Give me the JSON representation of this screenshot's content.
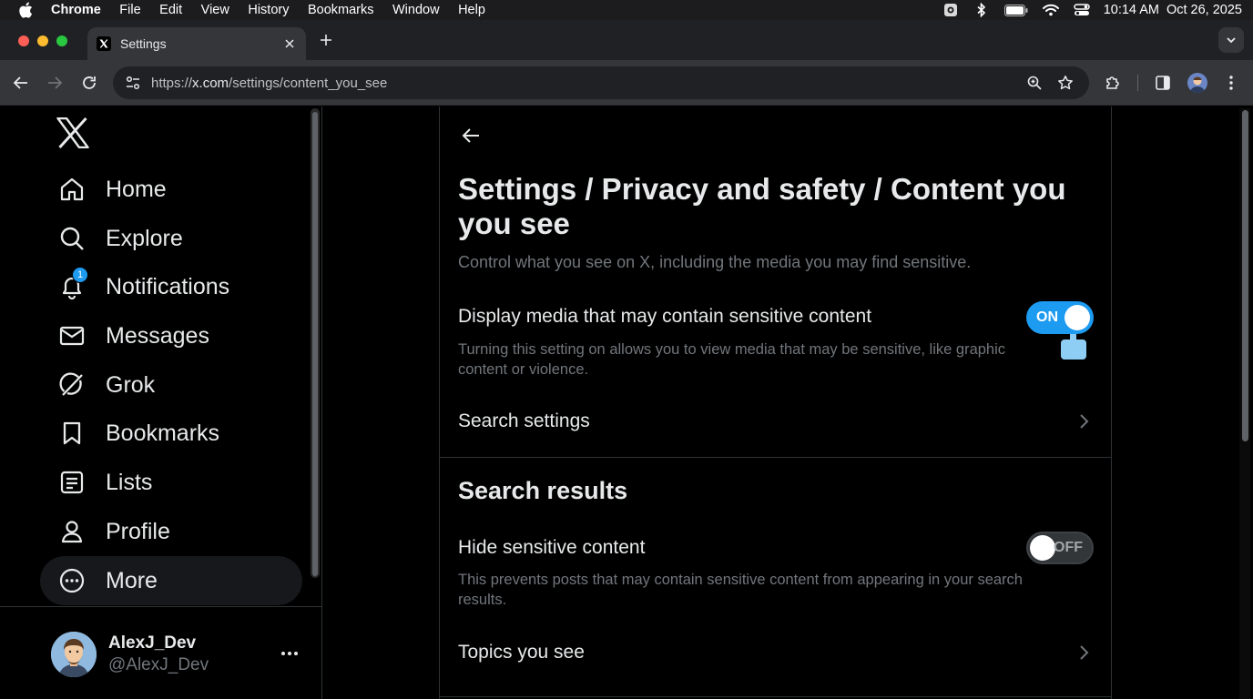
{
  "menubar": {
    "app": "Chrome",
    "items": [
      "File",
      "Edit",
      "View",
      "History",
      "Bookmarks",
      "Window",
      "Help"
    ],
    "clock": "10:14 AM",
    "date": "Oct 26, 2025"
  },
  "tab": {
    "title": "Settings"
  },
  "omnibox": {
    "scheme": "https://",
    "host": "x.com",
    "path": "/settings/content_you_see"
  },
  "nav": {
    "items": [
      {
        "label": "Home",
        "icon": "home-icon"
      },
      {
        "label": "Explore",
        "icon": "search-icon"
      },
      {
        "label": "Notifications",
        "icon": "bell-icon",
        "badge": "1"
      },
      {
        "label": "Messages",
        "icon": "envelope-icon"
      },
      {
        "label": "Grok",
        "icon": "grok-icon"
      },
      {
        "label": "Bookmarks",
        "icon": "bookmark-icon"
      },
      {
        "label": "Lists",
        "icon": "list-icon"
      },
      {
        "label": "Profile",
        "icon": "person-icon"
      },
      {
        "label": "More",
        "icon": "more-circle-icon",
        "active": true
      }
    ]
  },
  "account": {
    "display_name": "AlexJ_Dev",
    "handle": "@AlexJ_Dev"
  },
  "main": {
    "heading": "Settings / Privacy and safety / Content you you see",
    "description": "Control what you see on X, including the media you may find sensitive.",
    "sensitive_media": {
      "title": "Display media that may contain sensitive content",
      "subtitle": "Turning this setting on allows you to view media that may be sensitive, like graphic content or violence.",
      "toggle_label": "ON",
      "enabled": true
    },
    "search_settings_label": "Search settings",
    "search_results_heading": "Search results",
    "hide_sensitive": {
      "title": "Hide sensitive content",
      "subtitle": "This prevents posts that may contain sensitive content from appearing in your search results.",
      "toggle_label": "OFF",
      "enabled": false
    },
    "topics_label": "Topics you see"
  },
  "colors": {
    "accent": "#1d9bf0",
    "background": "#000000",
    "text_primary": "#e7e9ea",
    "text_secondary": "#71767b",
    "border": "#2f3336"
  }
}
